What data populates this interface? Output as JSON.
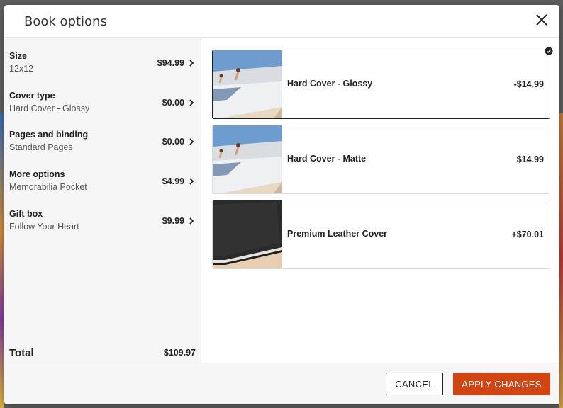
{
  "dialog": {
    "title": "Book options"
  },
  "sidebar": {
    "items": [
      {
        "label": "Size",
        "value": "12x12",
        "price": "$94.99"
      },
      {
        "label": "Cover type",
        "value": "Hard Cover - Glossy",
        "price": "$0.00"
      },
      {
        "label": "Pages and binding",
        "value": "Standard Pages",
        "price": "$0.00"
      },
      {
        "label": "More options",
        "value": "Memorabilia Pocket",
        "price": "$4.99"
      },
      {
        "label": "Gift box",
        "value": "Follow Your Heart",
        "price": "$9.99"
      }
    ],
    "total_label": "Total",
    "total_value": "$109.97"
  },
  "options": [
    {
      "name": "Hard Cover - Glossy",
      "price": "-$14.99",
      "selected": true,
      "thumb": "photo-cover"
    },
    {
      "name": "Hard Cover - Matte",
      "price": "$14.99",
      "selected": false,
      "thumb": "photo-cover"
    },
    {
      "name": "Premium Leather Cover",
      "price": "+$70.01",
      "selected": false,
      "thumb": "leather-cover"
    }
  ],
  "footer": {
    "cancel_label": "CANCEL",
    "apply_label": "APPLY CHANGES"
  },
  "colors": {
    "accent": "#d24411",
    "sidebar_bg": "#f6f6f7",
    "selected_border": "#222222"
  },
  "icons": {
    "close": "close-icon",
    "chevron": "chevron-right-icon",
    "check": "check-circle-icon"
  }
}
